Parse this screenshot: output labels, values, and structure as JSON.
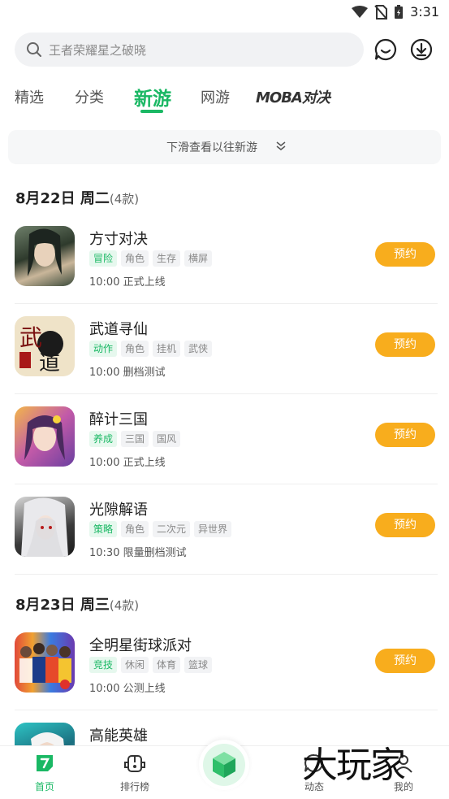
{
  "status_bar": {
    "time": "3:31"
  },
  "search": {
    "placeholder": "王者荣耀星之破晓"
  },
  "icons": {
    "search": "search-icon",
    "message": "message-icon",
    "download": "download-icon",
    "chevron": "chevron-down-icon"
  },
  "tabs": [
    {
      "label": "精选"
    },
    {
      "label": "分类"
    },
    {
      "label": "新游"
    },
    {
      "label": "网游"
    },
    {
      "label": "MOBA对决"
    }
  ],
  "pulldown_hint": "下滑查看以往新游",
  "sections": [
    {
      "date": "8月22日 周二",
      "count": "(4款)",
      "games": [
        {
          "name": "方寸对决",
          "tags": [
            "冒险",
            "角色",
            "生存",
            "横屏"
          ],
          "time": "10:00",
          "status": "正式上线",
          "button": "预约"
        },
        {
          "name": "武道寻仙",
          "tags": [
            "动作",
            "角色",
            "挂机",
            "武侠"
          ],
          "time": "10:00",
          "status": "删档测试",
          "button": "预约"
        },
        {
          "name": "醉计三国",
          "tags": [
            "养成",
            "三国",
            "国风"
          ],
          "time": "10:00",
          "status": "正式上线",
          "button": "预约"
        },
        {
          "name": "光隙解语",
          "tags": [
            "策略",
            "角色",
            "二次元",
            "异世界"
          ],
          "time": "10:30",
          "status": "限量删档测试",
          "button": "预约"
        }
      ]
    },
    {
      "date": "8月23日 周三",
      "count": "(4款)",
      "games": [
        {
          "name": "全明星街球派对",
          "tags": [
            "竞技",
            "休闲",
            "体育",
            "篮球"
          ],
          "time": "10:00",
          "status": "公测上线",
          "button": "预约"
        },
        {
          "name": "高能英雄",
          "tags": [],
          "time": "",
          "status": "",
          "button": ""
        }
      ]
    }
  ],
  "bottom_nav": [
    {
      "label": "首页"
    },
    {
      "label": "排行榜"
    },
    {
      "label": ""
    },
    {
      "label": "动态"
    },
    {
      "label": "我的"
    }
  ],
  "watermark": "大玩家",
  "colors": {
    "accent": "#1ab864",
    "reserve_button": "#f8ad1d"
  }
}
